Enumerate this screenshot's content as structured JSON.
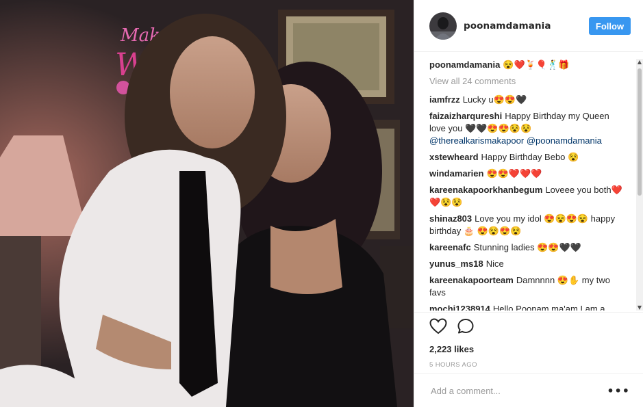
{
  "post": {
    "username": "poonamdamania",
    "follow_label": "Follow",
    "caption": {
      "user": "poonamdamania",
      "text": "😵❤️🍹🎈🕺🎁"
    },
    "view_all": "View all 24 comments",
    "comments": [
      {
        "user": "iamfrzz",
        "text": "Lucky u😍😍🖤"
      },
      {
        "user": "faizaizharqureshi",
        "text": "Happy Birthday my Queen love you 🖤🖤😍😍😵😵",
        "mentions": "@therealkarismakapoor @poonamdamania"
      },
      {
        "user": "xstewheard",
        "text": "Happy Birthday Bebo 😵"
      },
      {
        "user": "windamarien",
        "text": "😍😍❤️❤️❤️"
      },
      {
        "user": "kareenakapoorkhanbegum",
        "text": "Loveee you both❤️❤️😵😵"
      },
      {
        "user": "shinaz803",
        "text": "Love you my idol 😍😵😍😵 happy birthday 🎂 😍😵😍😵"
      },
      {
        "user": "kareenafc",
        "text": "Stunning ladies 😍😍🖤🖤"
      },
      {
        "user": "yunus_ms18",
        "text": "Nice"
      },
      {
        "user": "kareenakapoorteam",
        "text": "Damnnnn 😍✋ my two favs"
      },
      {
        "user": "mochi1238914",
        "text": "Hello Poonam ma'am I am a"
      }
    ],
    "likes": "2,223 likes",
    "time_ago": "5 HOURS AGO",
    "add_comment_placeholder": "Add a comment...",
    "more_label": "•••",
    "icons": {
      "like": "heart-icon",
      "comment": "comment-icon",
      "more": "more-options-icon"
    }
  },
  "colors": {
    "accent": "#3897f0",
    "mention": "#003569",
    "muted": "#999999"
  }
}
